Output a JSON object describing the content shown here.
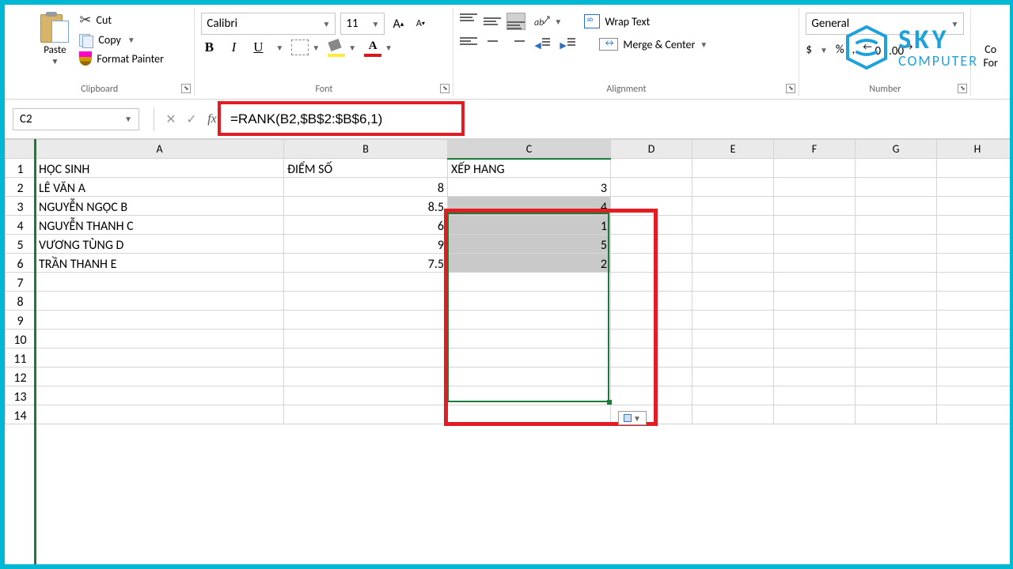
{
  "ribbon": {
    "clipboard": {
      "paste": "Paste",
      "cut": "Cut",
      "copy": "Copy",
      "format_painter": "Format Painter",
      "group": "Clipboard"
    },
    "font": {
      "name": "Calibri",
      "size": "11",
      "bold": "B",
      "italic": "I",
      "underline": "U",
      "grow": "A",
      "shrink": "A",
      "color_letter": "A",
      "group": "Font"
    },
    "alignment": {
      "wrap": "Wrap Text",
      "merge": "Merge & Center",
      "group": "Alignment"
    },
    "number": {
      "format": "General",
      "currency": "$",
      "percent": "%",
      "comma": ",",
      "inc_dec": ".0",
      "group": "Number"
    },
    "styles": {
      "cond": "Co"
    }
  },
  "logo": {
    "l1": "SKY",
    "l2": "COMPUTER"
  },
  "fbar": {
    "cell": "C2",
    "formula": "=RANK(B2,$B$2:$B$6,1)"
  },
  "cols": [
    "A",
    "B",
    "C",
    "D",
    "E",
    "F",
    "G",
    "H"
  ],
  "headers": {
    "a": "HỌC SINH",
    "b": "ĐIỂM SỐ",
    "c": "XẾP HANG"
  },
  "rows": [
    {
      "a": "LÊ VĂN A",
      "b": "8",
      "c": "3"
    },
    {
      "a": "NGUYỄN NGỌC B",
      "b": "8.5",
      "c": "4"
    },
    {
      "a": "NGUYỄN THANH C",
      "b": "6",
      "c": "1"
    },
    {
      "a": "VƯƠNG TÙNG D",
      "b": "9",
      "c": "5"
    },
    {
      "a": "TRẦN THANH E",
      "b": "7.5",
      "c": "2"
    }
  ]
}
